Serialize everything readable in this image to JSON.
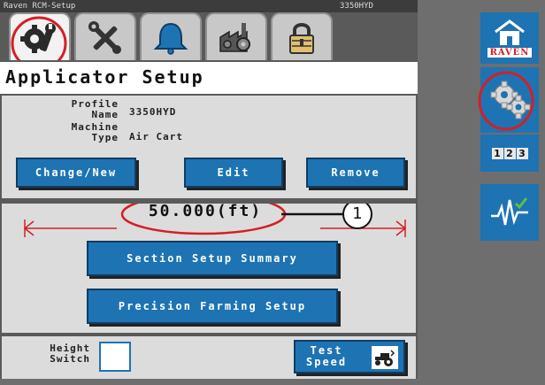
{
  "titlebar": {
    "app_name": "Raven RCM-Setup",
    "model": "3350HYD"
  },
  "tabs": [
    {
      "name": "tab-setup",
      "icon": "settings-wrench-icon",
      "active": true
    },
    {
      "name": "tab-tools",
      "icon": "tools-icon",
      "active": false
    },
    {
      "name": "tab-alarms",
      "icon": "bell-icon",
      "active": false
    },
    {
      "name": "tab-machine",
      "icon": "factory-gear-icon",
      "active": false
    },
    {
      "name": "tab-lock",
      "icon": "padlock-icon",
      "active": false
    }
  ],
  "header": {
    "title": "Applicator Setup"
  },
  "profile": {
    "profile_label_1": "Profile",
    "profile_label_2": "Name",
    "profile_value": "3350HYD",
    "machine_label_1": "Machine",
    "machine_label_2": "Type",
    "machine_value": "Air Cart"
  },
  "buttons": {
    "change_new": "Change/New",
    "edit": "Edit",
    "remove": "Remove",
    "section_setup_summary": "Section Setup Summary",
    "precision_farming_setup": "Precision Farming Setup"
  },
  "width": {
    "value": "50.000(ft)",
    "callout_number": "1"
  },
  "bottom": {
    "height_label_1": "Height",
    "height_label_2": "Switch",
    "height_switch_checked": false,
    "test_label_1": "Test",
    "test_label_2": "Speed"
  },
  "sidebar": {
    "brand": "RAVEN",
    "counter": [
      "1",
      "2",
      "3"
    ]
  },
  "colors": {
    "button_blue": "#1e73b3",
    "highlight_red": "#d41f26",
    "panel_gray": "#dcdcdc",
    "background_dark": "#5a5a5a"
  }
}
